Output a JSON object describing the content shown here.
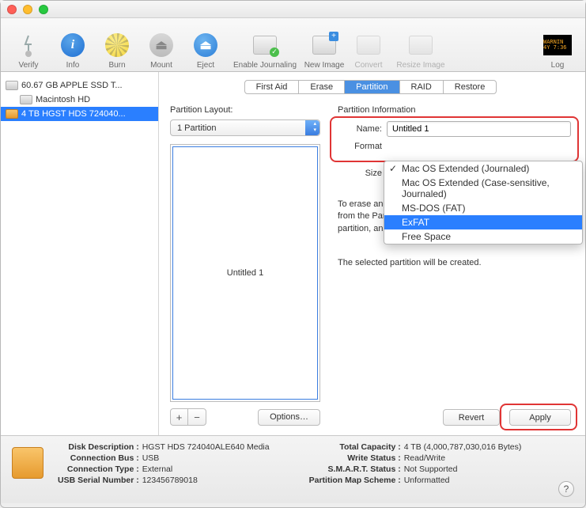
{
  "toolbar": {
    "verify": "Verify",
    "info": "Info",
    "burn": "Burn",
    "mount": "Mount",
    "eject": "Eject",
    "enable_journaling": "Enable Journaling",
    "new_image": "New Image",
    "convert": "Convert",
    "resize_image": "Resize Image",
    "log": "Log",
    "log_badge": "WARNIN\n4Y 7:36"
  },
  "sidebar": {
    "items": [
      {
        "label": "60.67 GB APPLE SSD T..."
      },
      {
        "label": "Macintosh HD"
      },
      {
        "label": "4 TB HGST HDS 724040..."
      }
    ]
  },
  "tabs": {
    "first_aid": "First Aid",
    "erase": "Erase",
    "partition": "Partition",
    "raid": "RAID",
    "restore": "Restore"
  },
  "partition": {
    "layout_label": "Partition Layout:",
    "layout_value": "1 Partition",
    "diagram_label": "Untitled 1",
    "options_btn": "Options…",
    "info_label": "Partition Information",
    "name_label": "Name:",
    "name_value": "Untitled 1",
    "format_label": "Format",
    "size_label": "Size",
    "help1": "To erase and partition the selected disk, choose a layout from the Partition Layout pop-up menu, set options for each partition, and click Apply.",
    "help2": "The selected partition will be created.",
    "revert_btn": "Revert",
    "apply_btn": "Apply",
    "add_btn": "+",
    "remove_btn": "−",
    "format_options": [
      "Mac OS Extended (Journaled)",
      "Mac OS Extended (Case-sensitive, Journaled)",
      "MS-DOS (FAT)",
      "ExFAT",
      "Free Space"
    ]
  },
  "footer": {
    "disk_description_k": "Disk Description :",
    "disk_description_v": "HGST HDS 724040ALE640 Media",
    "connection_bus_k": "Connection Bus :",
    "connection_bus_v": "USB",
    "connection_type_k": "Connection Type :",
    "connection_type_v": "External",
    "usb_serial_k": "USB Serial Number :",
    "usb_serial_v": "123456789018",
    "total_capacity_k": "Total Capacity :",
    "total_capacity_v": "4 TB (4,000,787,030,016 Bytes)",
    "write_status_k": "Write Status :",
    "write_status_v": "Read/Write",
    "smart_status_k": "S.M.A.R.T. Status :",
    "smart_status_v": "Not Supported",
    "partition_map_k": "Partition Map Scheme :",
    "partition_map_v": "Unformatted",
    "help_btn": "?"
  }
}
